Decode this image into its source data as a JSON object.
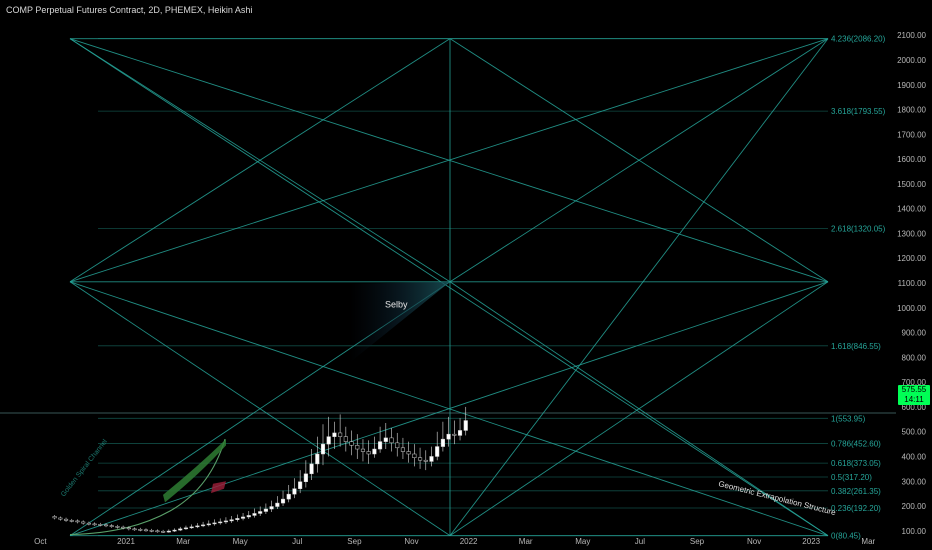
{
  "header": {
    "title": "COMP Perpetual Futures Contract, 2D, PHEMEX, Heikin Ashi"
  },
  "price_tag": {
    "price": "575.55",
    "sub": "14:11"
  },
  "annotations": {
    "selby": "Selby",
    "geometric": "Geometric Extrapolation Structure",
    "channel": "Golden Spiral Channel"
  },
  "colors": {
    "background": "#000000",
    "teal": "#26a69a",
    "green_band": "#2e7d32",
    "price_tag": "#00ff55"
  },
  "chart_data": {
    "type": "line",
    "title": "COMP Perpetual Futures Contract, 2D, PHEMEX, Heikin Ashi",
    "chart_style": "candlestick (Heikin Ashi)",
    "y_axis": {
      "position": "right",
      "ticks": [
        100,
        200,
        300,
        400,
        500,
        600,
        700,
        800,
        900,
        1000,
        1100,
        1200,
        1300,
        1400,
        1500,
        1600,
        1700,
        1800,
        1900,
        2000,
        2100
      ],
      "ylim": [
        50,
        2110
      ]
    },
    "x_axis": {
      "ticks": [
        "Oct",
        "2021",
        "Mar",
        "May",
        "Jul",
        "Sep",
        "Nov",
        "2022",
        "Mar",
        "May",
        "Jul",
        "Sep",
        "Nov",
        "2023",
        "Mar"
      ]
    },
    "fib_levels": [
      {
        "label": "0(80.45)",
        "value": 80.45
      },
      {
        "label": "0.236(192.20)",
        "value": 192.2
      },
      {
        "label": "0.382(261.35)",
        "value": 261.35
      },
      {
        "label": "0.5(317.20)",
        "value": 317.2
      },
      {
        "label": "0.618(373.05)",
        "value": 373.05
      },
      {
        "label": "0.786(452.60)",
        "value": 452.6
      },
      {
        "label": "1(553.95)",
        "value": 553.95
      },
      {
        "label": "1.618(846.55)",
        "value": 846.55
      },
      {
        "label": "2.618(1320.05)",
        "value": 1320.05
      },
      {
        "label": "3.618(1793.55)",
        "value": 1793.55
      },
      {
        "label": "4.236(2086.20)",
        "value": 2086.2
      }
    ],
    "current_price": 575.55,
    "candles": [
      [
        -2.5,
        158,
        152,
        164,
        146
      ],
      [
        -2.3,
        152,
        147,
        158,
        141
      ],
      [
        -2.1,
        147,
        142,
        153,
        136
      ],
      [
        -1.9,
        142,
        140,
        148,
        134
      ],
      [
        -1.7,
        140,
        136,
        146,
        130
      ],
      [
        -1.5,
        136,
        131,
        142,
        125
      ],
      [
        -1.3,
        131,
        128,
        137,
        122
      ],
      [
        -1.1,
        128,
        126,
        134,
        120
      ],
      [
        -0.9,
        126,
        124,
        132,
        118
      ],
      [
        -0.7,
        124,
        121,
        130,
        115
      ],
      [
        -0.5,
        121,
        118,
        127,
        112
      ],
      [
        -0.3,
        118,
        115,
        124,
        109
      ],
      [
        -0.1,
        115,
        112,
        121,
        106
      ],
      [
        0.1,
        112,
        108,
        118,
        102
      ],
      [
        0.3,
        108,
        106,
        114,
        100
      ],
      [
        0.5,
        106,
        104,
        112,
        98
      ],
      [
        0.7,
        104,
        102,
        110,
        96
      ],
      [
        0.9,
        102,
        100,
        108,
        94
      ],
      [
        1.1,
        100,
        98,
        106,
        92
      ],
      [
        1.3,
        98,
        97,
        104,
        91
      ],
      [
        1.5,
        97,
        99,
        106,
        92
      ],
      [
        1.7,
        99,
        103,
        110,
        95
      ],
      [
        1.9,
        103,
        108,
        116,
        99
      ],
      [
        2.1,
        108,
        112,
        121,
        104
      ],
      [
        2.3,
        112,
        116,
        126,
        108
      ],
      [
        2.5,
        116,
        120,
        131,
        111
      ],
      [
        2.7,
        120,
        124,
        136,
        115
      ],
      [
        2.9,
        124,
        128,
        142,
        118
      ],
      [
        3.1,
        128,
        132,
        146,
        121
      ],
      [
        3.3,
        132,
        136,
        150,
        125
      ],
      [
        3.5,
        136,
        140,
        155,
        128
      ],
      [
        3.7,
        140,
        145,
        160,
        132
      ],
      [
        3.9,
        145,
        150,
        166,
        137
      ],
      [
        4.1,
        150,
        156,
        172,
        142
      ],
      [
        4.3,
        156,
        162,
        180,
        148
      ],
      [
        4.5,
        162,
        170,
        190,
        153
      ],
      [
        4.7,
        170,
        178,
        198,
        160
      ],
      [
        4.9,
        178,
        188,
        210,
        168
      ],
      [
        5.1,
        188,
        198,
        222,
        176
      ],
      [
        5.3,
        198,
        212,
        240,
        188
      ],
      [
        5.5,
        212,
        228,
        262,
        200
      ],
      [
        5.7,
        228,
        248,
        285,
        215
      ],
      [
        5.9,
        248,
        270,
        312,
        232
      ],
      [
        6.1,
        270,
        298,
        345,
        252
      ],
      [
        6.3,
        298,
        330,
        385,
        275
      ],
      [
        6.5,
        330,
        370,
        430,
        305
      ],
      [
        6.7,
        370,
        410,
        480,
        335
      ],
      [
        6.9,
        410,
        450,
        530,
        365
      ],
      [
        7.1,
        450,
        480,
        560,
        400
      ],
      [
        7.3,
        480,
        495,
        540,
        430
      ],
      [
        7.5,
        495,
        480,
        570,
        440
      ],
      [
        7.7,
        480,
        460,
        520,
        420
      ],
      [
        7.9,
        460,
        445,
        505,
        405
      ],
      [
        8.1,
        445,
        430,
        490,
        390
      ],
      [
        8.3,
        430,
        420,
        470,
        380
      ],
      [
        8.5,
        420,
        410,
        465,
        370
      ],
      [
        8.7,
        410,
        430,
        480,
        395
      ],
      [
        8.9,
        430,
        460,
        520,
        415
      ],
      [
        9.1,
        460,
        475,
        535,
        430
      ],
      [
        9.3,
        475,
        455,
        515,
        420
      ],
      [
        9.5,
        455,
        435,
        495,
        400
      ],
      [
        9.7,
        435,
        420,
        475,
        390
      ],
      [
        9.9,
        420,
        410,
        460,
        375
      ],
      [
        10.1,
        410,
        395,
        450,
        360
      ],
      [
        10.3,
        395,
        385,
        435,
        350
      ],
      [
        10.5,
        385,
        380,
        425,
        345
      ],
      [
        10.7,
        380,
        400,
        440,
        360
      ],
      [
        10.9,
        400,
        440,
        500,
        385
      ],
      [
        11.1,
        440,
        470,
        540,
        420
      ],
      [
        11.3,
        470,
        490,
        560,
        440
      ],
      [
        11.5,
        490,
        485,
        545,
        450
      ],
      [
        11.7,
        485,
        505,
        555,
        465
      ],
      [
        11.9,
        505,
        545,
        600,
        485
      ]
    ]
  }
}
